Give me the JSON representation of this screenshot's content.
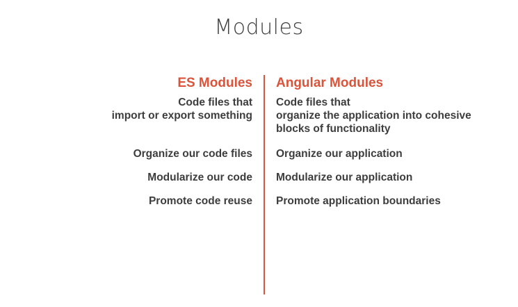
{
  "title": "Modules",
  "accent_color": "#d9543a",
  "left": {
    "heading": "ES Modules",
    "rows": [
      "Code files that\nimport or export something",
      "Organize our code files",
      "Modularize our code",
      "Promote code reuse"
    ]
  },
  "right": {
    "heading": "Angular Modules",
    "rows": [
      "Code files that\norganize the application into cohesive\nblocks of functionality",
      "Organize our application",
      "Modularize our application",
      "Promote application boundaries"
    ]
  }
}
